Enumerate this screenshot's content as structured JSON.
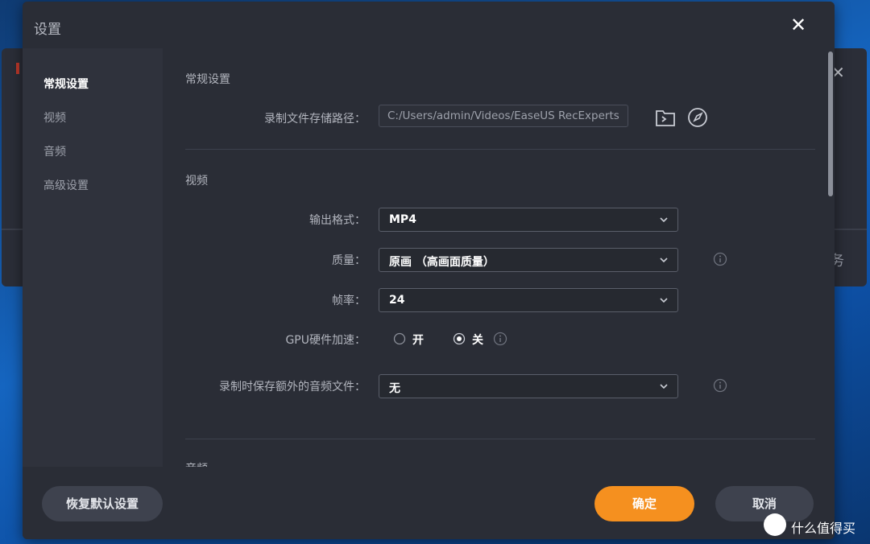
{
  "dialog": {
    "title": "设置",
    "close_glyph": "✕"
  },
  "background": {
    "partial_text": "务"
  },
  "sidebar": {
    "items": [
      {
        "label": "常规设置",
        "active": true
      },
      {
        "label": "视频",
        "active": false
      },
      {
        "label": "音频",
        "active": false
      },
      {
        "label": "高级设置",
        "active": false
      }
    ]
  },
  "general": {
    "section_title": "常规设置",
    "path_label": "录制文件存储路径：",
    "path_value": "C:/Users/admin/Videos/EaseUS RecExperts"
  },
  "video": {
    "section_title": "视频",
    "format_label": "输出格式：",
    "format_value": "MP4",
    "quality_label": "质量：",
    "quality_value": "原画 （高画面质量）",
    "framerate_label": "帧率：",
    "framerate_value": "24",
    "gpu_label": "GPU硬件加速：",
    "gpu_on_label": "开",
    "gpu_off_label": "关",
    "gpu_selected": "off",
    "extra_audio_label": "录制时保存额外的音频文件：",
    "extra_audio_value": "无"
  },
  "next_section": {
    "partial_title": "音频"
  },
  "footer": {
    "reset_label": "恢复默认设置",
    "ok_label": "确定",
    "cancel_label": "取消"
  },
  "watermark": {
    "text": "什么值得买"
  },
  "colors": {
    "accent": "#f5901f",
    "dialog_bg": "#2a2d36",
    "sidebar_bg": "#2f323c"
  },
  "icons": [
    "folder-open-icon",
    "compass-icon",
    "chevron-down-icon",
    "info-icon",
    "close-icon"
  ]
}
